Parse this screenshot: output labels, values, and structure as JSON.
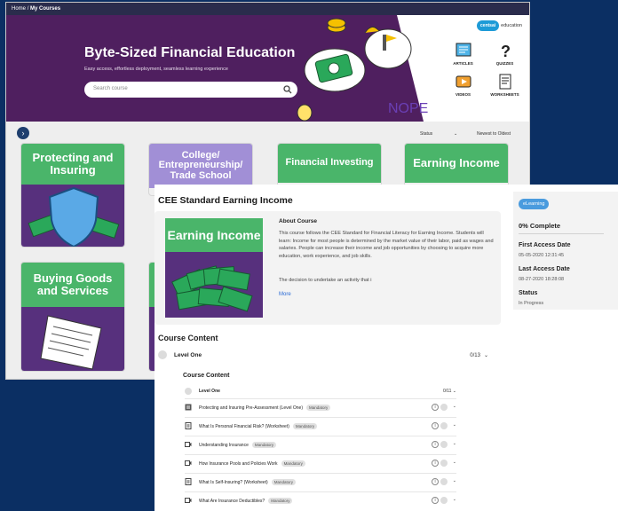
{
  "breadcrumb": {
    "home": "Home",
    "sep": "/",
    "current": "My Courses"
  },
  "hero": {
    "title": "Byte-Sized Financial Education",
    "subtitle": "Easy access, effortless deployment, seamless learning experience",
    "search_placeholder": "Search course",
    "doodle_text": "NOPE",
    "logo": {
      "brand": "centsai",
      "suffix": "education"
    },
    "resources": [
      {
        "label": "ARTICLES",
        "icon": "articles-icon"
      },
      {
        "label": "QUIZZES",
        "icon": "quizzes-icon"
      },
      {
        "label": "VIDEOS",
        "icon": "videos-icon"
      },
      {
        "label": "WORKSHEETS",
        "icon": "worksheets-icon"
      }
    ]
  },
  "filters": {
    "status": "Status",
    "sort": "Newest to Oldest"
  },
  "catalog": [
    {
      "title": "Protecting and Insuring",
      "color": "#4ab56a"
    },
    {
      "title": "College/ Entrepreneurship/ Trade School",
      "color": "#a18fd6"
    },
    {
      "title": "Financial Investing",
      "color": "#4ab56a"
    },
    {
      "title": "Earning Income",
      "color": "#4ab56a"
    },
    {
      "title": "Buying Goods and Services",
      "color": "#4ab56a"
    }
  ],
  "course": {
    "title": "CEE Standard Earning Income",
    "thumb_title": "Earning Income",
    "about_heading": "About Course",
    "about_text": "This course follows the CEE Standard for Financial Literacy for Earning Income. Students will learn: Income for most people is determined by the market value of their labor, paid as wages and salaries. People can increase their income and job opportunities by choosing to acquire more education, work experience, and job skills.",
    "about_trunc": "The decision to undertake an activity that i",
    "more_label": "More"
  },
  "sidebar": {
    "type_pill": "eLearning",
    "complete": "0% Complete",
    "first_access_label": "First Access Date",
    "first_access_value": "05-05-2020 12:31:45",
    "last_access_label": "Last Access Date",
    "last_access_value": "08-27-2020 18:28:08",
    "status_label": "Status",
    "status_value": "In Progress"
  },
  "content": {
    "heading": "Course Content",
    "level_name": "Level One",
    "level_count": "0/13",
    "inner_heading": "Course Content",
    "sub_level_name": "Level One",
    "sub_level_count": "0/11",
    "lessons": [
      {
        "name": "Protecting and Insuring Pre-Assessment (Level One)",
        "badge": "Mandatory",
        "icon": "assessment-icon"
      },
      {
        "name": "What Is Personal Financial Risk? (Worksheet)",
        "badge": "Mandatory",
        "icon": "document-icon"
      },
      {
        "name": "Understanding Insurance",
        "badge": "Mandatory",
        "icon": "video-icon"
      },
      {
        "name": "How Insurance Pools and Policies Work",
        "badge": "Mandatory",
        "icon": "video-icon"
      },
      {
        "name": "What Is Self-Insuring? (Worksheet)",
        "badge": "Mandatory",
        "icon": "document-icon"
      },
      {
        "name": "What Are Insurance Deductibles?",
        "badge": "Mandatory",
        "icon": "video-icon"
      }
    ],
    "info_glyph": "i",
    "chevron_glyph": "⌄"
  }
}
